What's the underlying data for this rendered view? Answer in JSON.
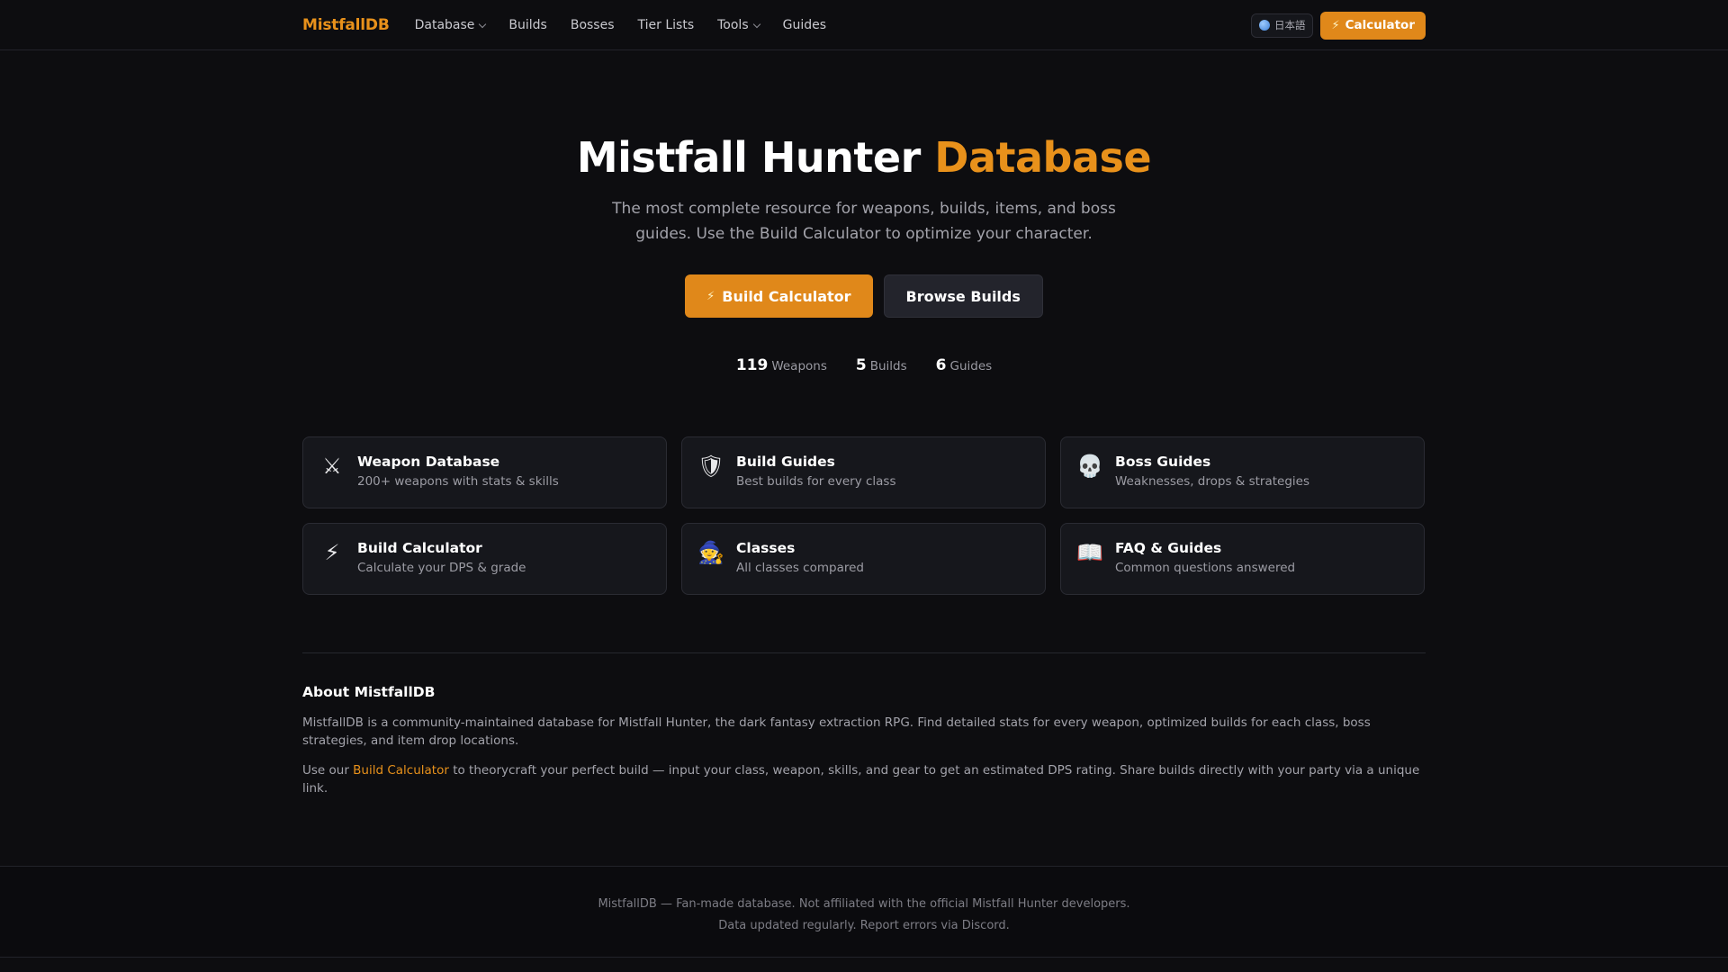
{
  "nav": {
    "logo": "MistfallDB",
    "links": [
      {
        "label": "Database",
        "dropdown": true
      },
      {
        "label": "Builds",
        "dropdown": false
      },
      {
        "label": "Bosses",
        "dropdown": false
      },
      {
        "label": "Tier Lists",
        "dropdown": false
      },
      {
        "label": "Tools",
        "dropdown": true
      },
      {
        "label": "Guides",
        "dropdown": false
      }
    ],
    "language": "日本語",
    "calculator_label": "Calculator",
    "accent_color": "#e0881a"
  },
  "hero": {
    "title_main": "Mistfall Hunter",
    "title_accent": "Database",
    "subtitle": "The most complete resource for weapons, builds, items, and boss guides. Use the Build Calculator to optimize your character.",
    "primary_button": "Build Calculator",
    "secondary_button": "Browse Builds"
  },
  "stats": [
    {
      "value": "119",
      "label": "Weapons"
    },
    {
      "value": "5",
      "label": "Builds"
    },
    {
      "value": "6",
      "label": "Guides"
    }
  ],
  "cards": [
    {
      "icon": "crossed-swords-icon",
      "glyph": "⚔",
      "title": "Weapon Database",
      "desc": "200+ weapons with stats & skills"
    },
    {
      "icon": "shield-icon",
      "glyph": "🛡",
      "title": "Build Guides",
      "desc": "Best builds for every class"
    },
    {
      "icon": "skull-icon",
      "glyph": "💀",
      "title": "Boss Guides",
      "desc": "Weaknesses, drops & strategies"
    },
    {
      "icon": "lightning-icon",
      "glyph": "⚡",
      "title": "Build Calculator",
      "desc": "Calculate your DPS & grade"
    },
    {
      "icon": "mage-icon",
      "glyph": "🧙",
      "title": "Classes",
      "desc": "All classes compared"
    },
    {
      "icon": "book-icon",
      "glyph": "📖",
      "title": "FAQ & Guides",
      "desc": "Common questions answered"
    }
  ],
  "about": {
    "title": "About MistfallDB",
    "p1": "MistfallDB is a community-maintained database for Mistfall Hunter, the dark fantasy extraction RPG. Find detailed stats for every weapon, optimized builds for each class, boss strategies, and item drop locations.",
    "p2_before": "Use our ",
    "p2_link": "Build Calculator",
    "p2_after": " to theorycraft your perfect build — input your class, weapon, skills, and gear to get an estimated DPS rating. Share builds directly with your party via a unique link."
  },
  "footer": {
    "line1": "MistfallDB — Fan-made database. Not affiliated with the official Mistfall Hunter developers.",
    "line2": "Data updated regularly. Report errors via Discord."
  }
}
